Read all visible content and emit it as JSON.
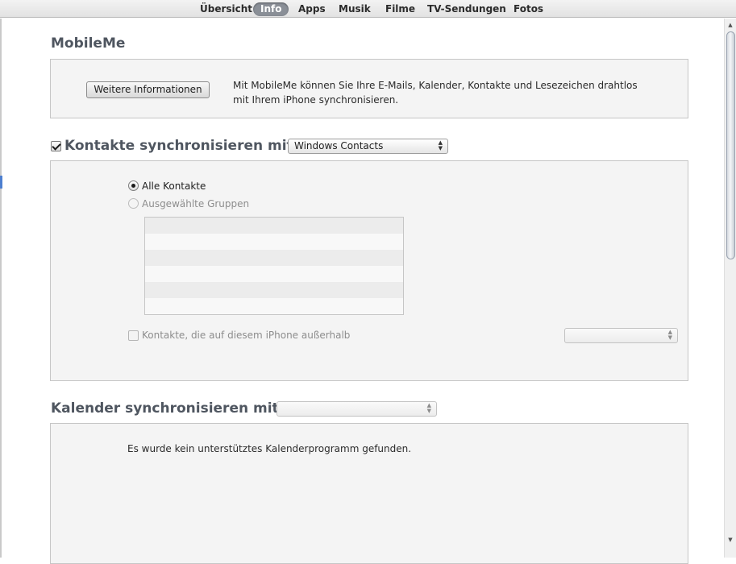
{
  "tabs": [
    {
      "label": "Übersicht",
      "active": false
    },
    {
      "label": "Info",
      "active": true
    },
    {
      "label": "Apps",
      "active": false
    },
    {
      "label": "Musik",
      "active": false
    },
    {
      "label": "Filme",
      "active": false
    },
    {
      "label": "TV-Sendungen",
      "active": false
    },
    {
      "label": "Fotos",
      "active": false
    }
  ],
  "mobileme": {
    "title": "MobileMe",
    "button_label": "Weitere Informationen",
    "description_line1": "Mit MobileMe können Sie Ihre E-Mails, Kalender, Kontakte und Lesezeichen drahtlos",
    "description_line2": "mit Ihrem iPhone synchronisieren."
  },
  "contacts": {
    "title": "Kontakte synchronisieren mit",
    "checked": true,
    "source_value": "Windows Contacts",
    "radio_all": "Alle Kontakte",
    "radio_selected": "Ausgewählte Gruppen",
    "outside_checkbox_label": "Kontakte, die auf diesem iPhone außerhalb",
    "outside_select_value": "",
    "group_rows": 6
  },
  "calendar": {
    "title": "Kalender synchronisieren mit",
    "source_value": "",
    "message": "Es wurde kein unterstütztes Kalenderprogramm gefunden."
  },
  "icons": {
    "select_arrows": "updown-arrows-icon",
    "scroll_up": "scroll-up-arrow-icon",
    "scroll_down": "scroll-down-arrow-icon"
  }
}
